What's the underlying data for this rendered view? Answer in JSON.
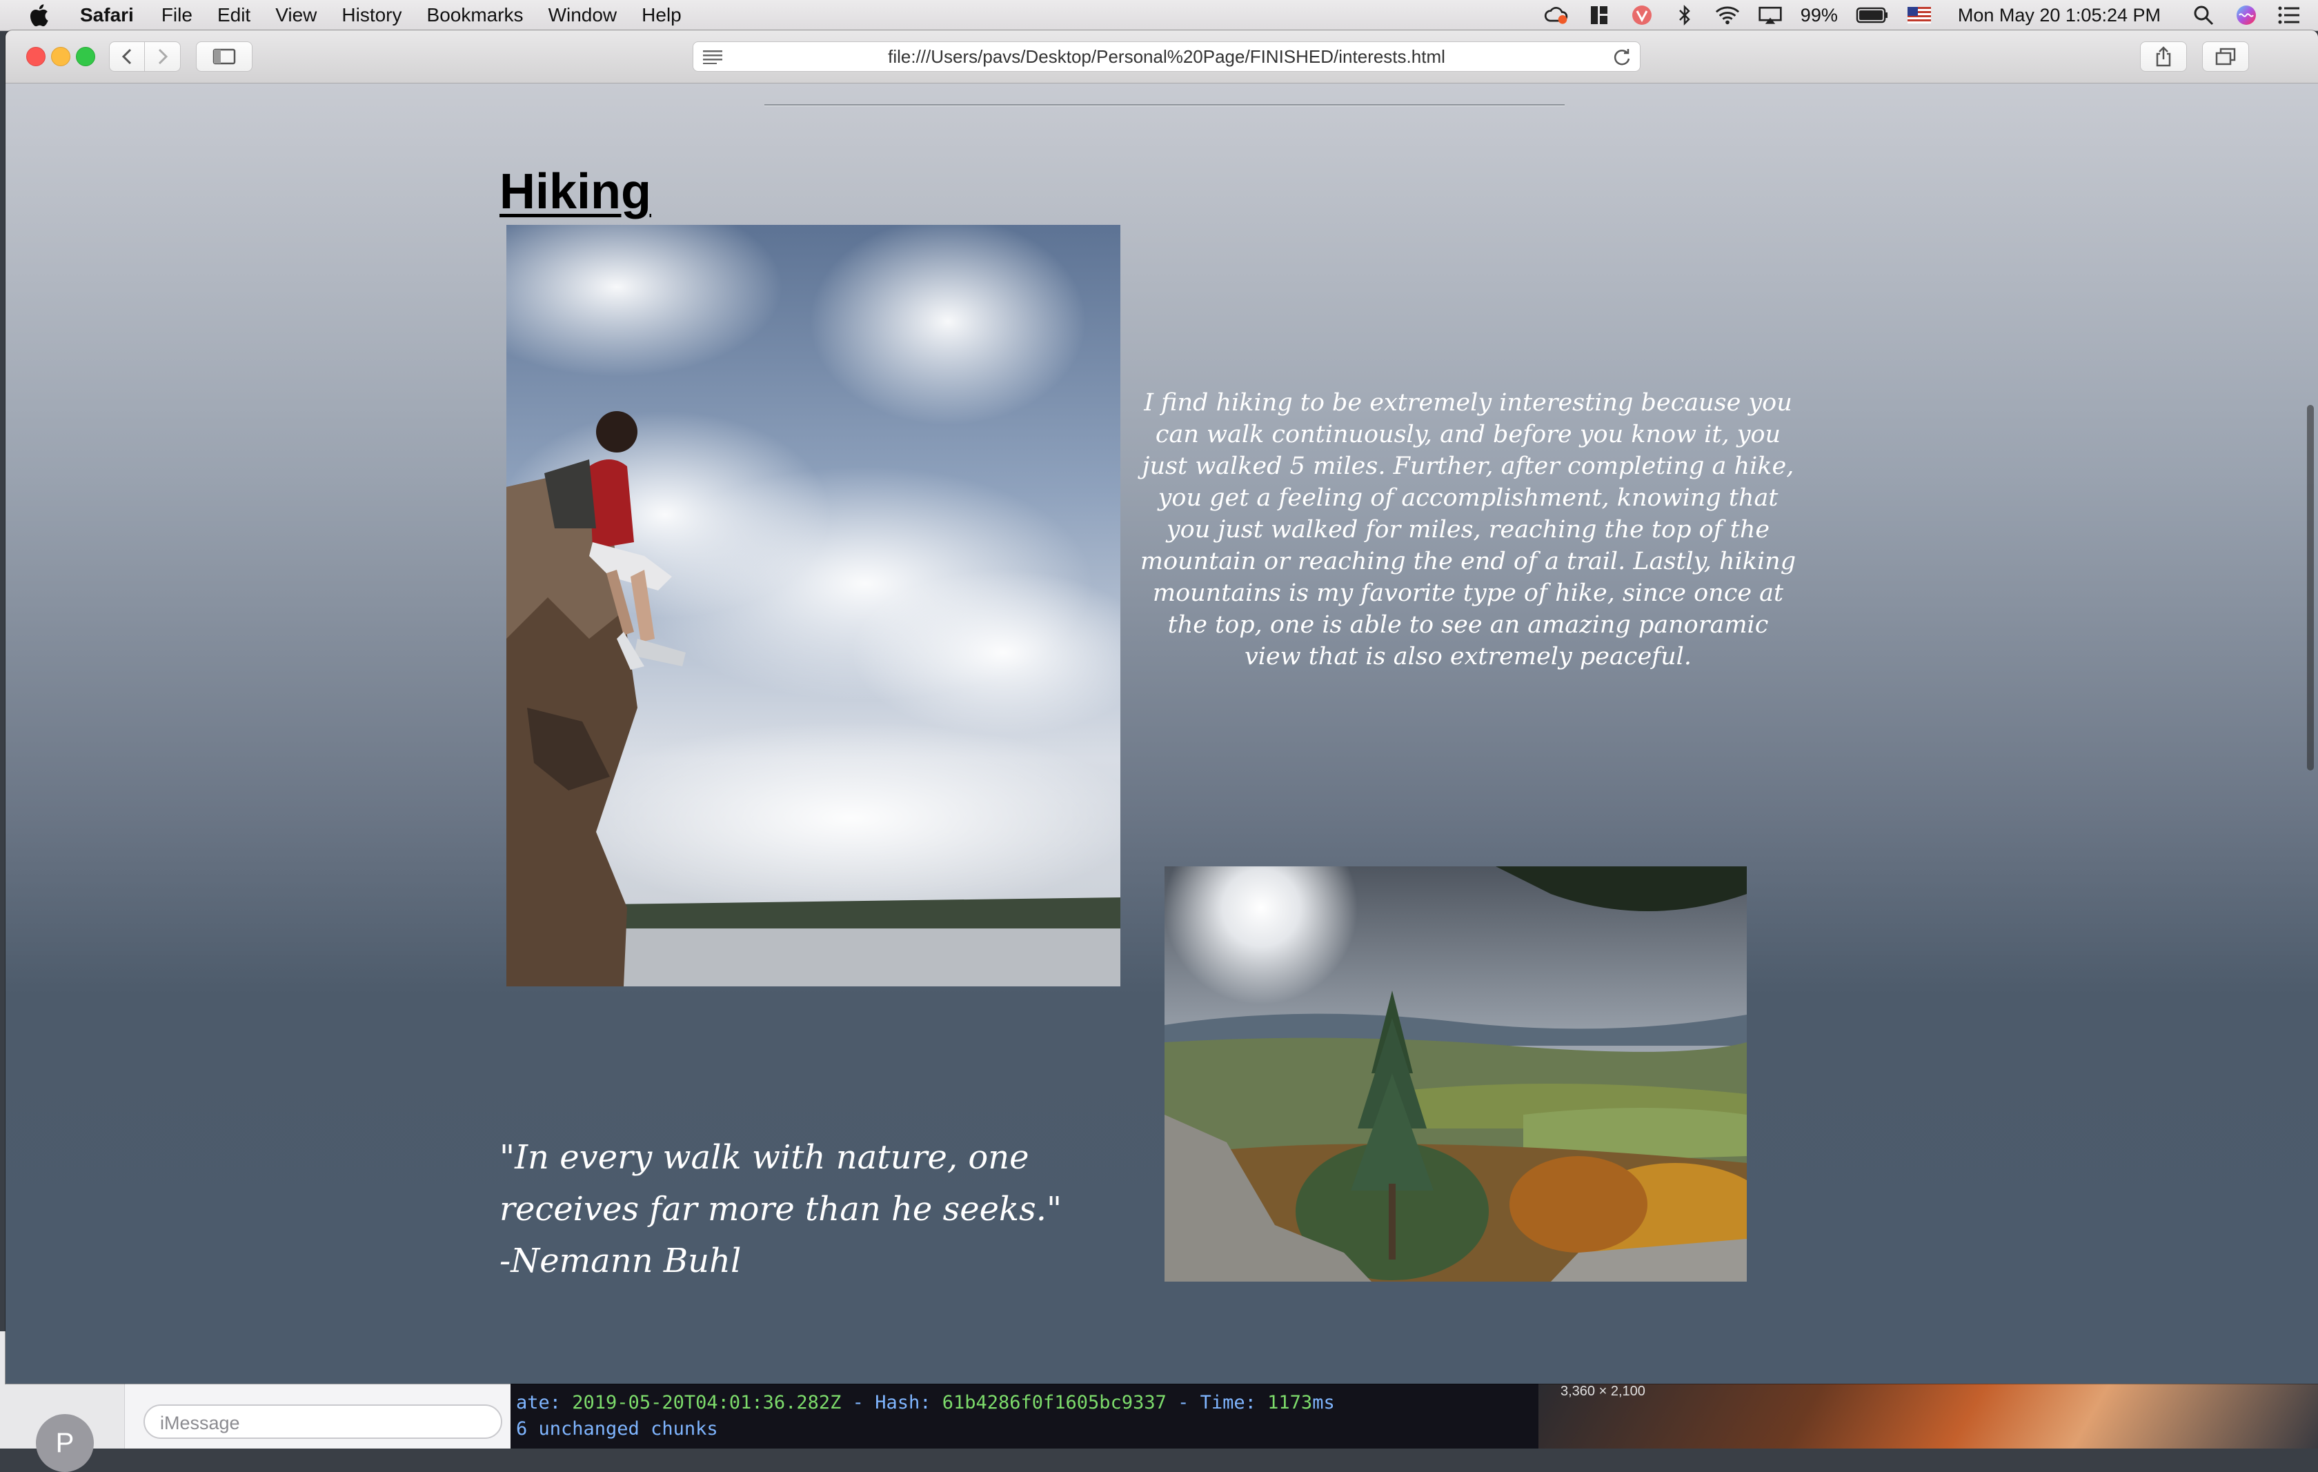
{
  "menubar": {
    "app_name": "Safari",
    "menus": [
      "File",
      "Edit",
      "View",
      "History",
      "Bookmarks",
      "Window",
      "Help"
    ],
    "battery": "99%",
    "clock": "Mon May 20  1:05:24 PM"
  },
  "safari": {
    "url": "file:///Users/pavs/Desktop/Personal%20Page/FINISHED/interests.html"
  },
  "page": {
    "heading": "Hiking",
    "paragraph": "I find hiking to be extremely interesting because you can walk continuously, and before you know it, you just walked 5 miles. Further, after completing a hike, you get a feeling of accomplishment, knowing that you just walked for miles, reaching the top of the mountain or reaching the end of a trail. Lastly, hiking mountains is my favorite type of hike, since once at the top, one is able to see an amazing panoramic view that is also extremely peaceful.",
    "quote_line": "\"In every walk with nature, one receives far more than he seeks.\"",
    "quote_author": "-Nemann Buhl"
  },
  "background": {
    "imessage_placeholder": "iMessage",
    "avatar_letter": "P",
    "terminal_prefix": "ate: ",
    "terminal_date": "2019-05-20T04:01:36.282Z",
    "terminal_sep1": " - Hash: ",
    "terminal_hash": "61b4286f0f1605bc9337",
    "terminal_sep2": " - Time: ",
    "terminal_time": "1173",
    "terminal_unit": "ms",
    "terminal_line2": "6 unchanged chunks",
    "photo_dims": "3,360 × 2,100"
  },
  "colors": {
    "page_top": "#c8cbd2",
    "page_bottom": "#4c5b6c",
    "traffic_red": "#fc5753",
    "traffic_yellow": "#fdbc40",
    "traffic_green": "#33c748"
  }
}
